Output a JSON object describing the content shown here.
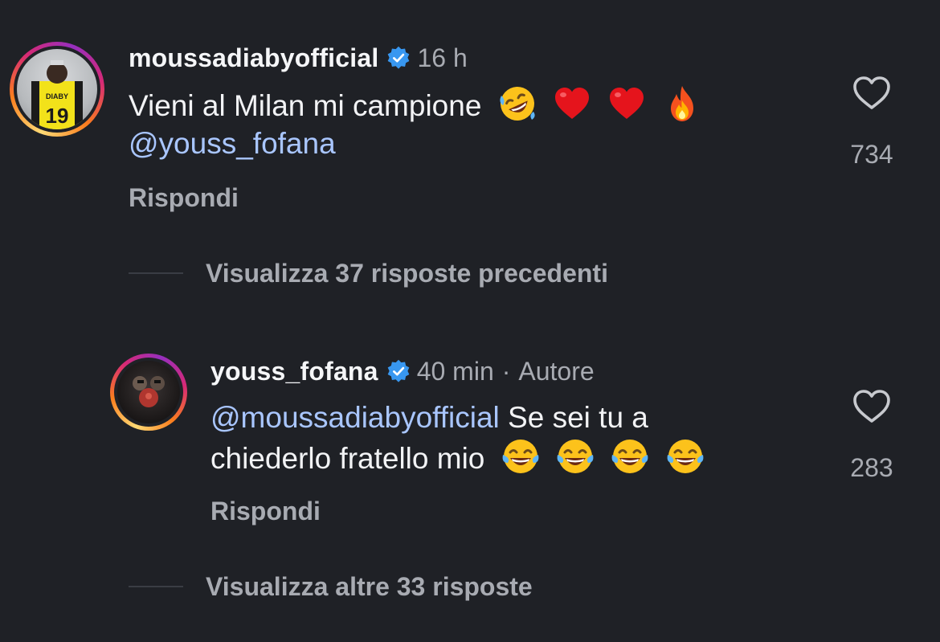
{
  "comments": [
    {
      "username": "moussadiabyofficial",
      "time": "16 h",
      "line1": "Vieni al Milan mi campione",
      "line2": "@youss_fofana",
      "emojis": [
        "rofl-emoji",
        "red-heart-emoji",
        "red-heart-emoji",
        "fire-emoji"
      ],
      "reply_label": "Rispondi",
      "likes": "734"
    },
    {
      "username": "youss_fofana",
      "time": "40 min",
      "separator": "·",
      "author_tag": "Autore",
      "mention": "@moussadiabyofficial",
      "line1_rest": " Se sei tu a",
      "line2": "chiederlo fratello mio",
      "emojis": [
        "tears-of-joy-emoji",
        "tears-of-joy-emoji",
        "tears-of-joy-emoji",
        "tears-of-joy-emoji"
      ],
      "reply_label": "Rispondi",
      "likes": "283"
    }
  ],
  "view_previous": "Visualizza 37 risposte precedenti",
  "view_more": "Visualizza altre 33 risposte",
  "colors": {
    "background": "#1f2126",
    "mention": "#a9c6ff",
    "verified": "#3897f0",
    "muted": "#a8abb2"
  }
}
